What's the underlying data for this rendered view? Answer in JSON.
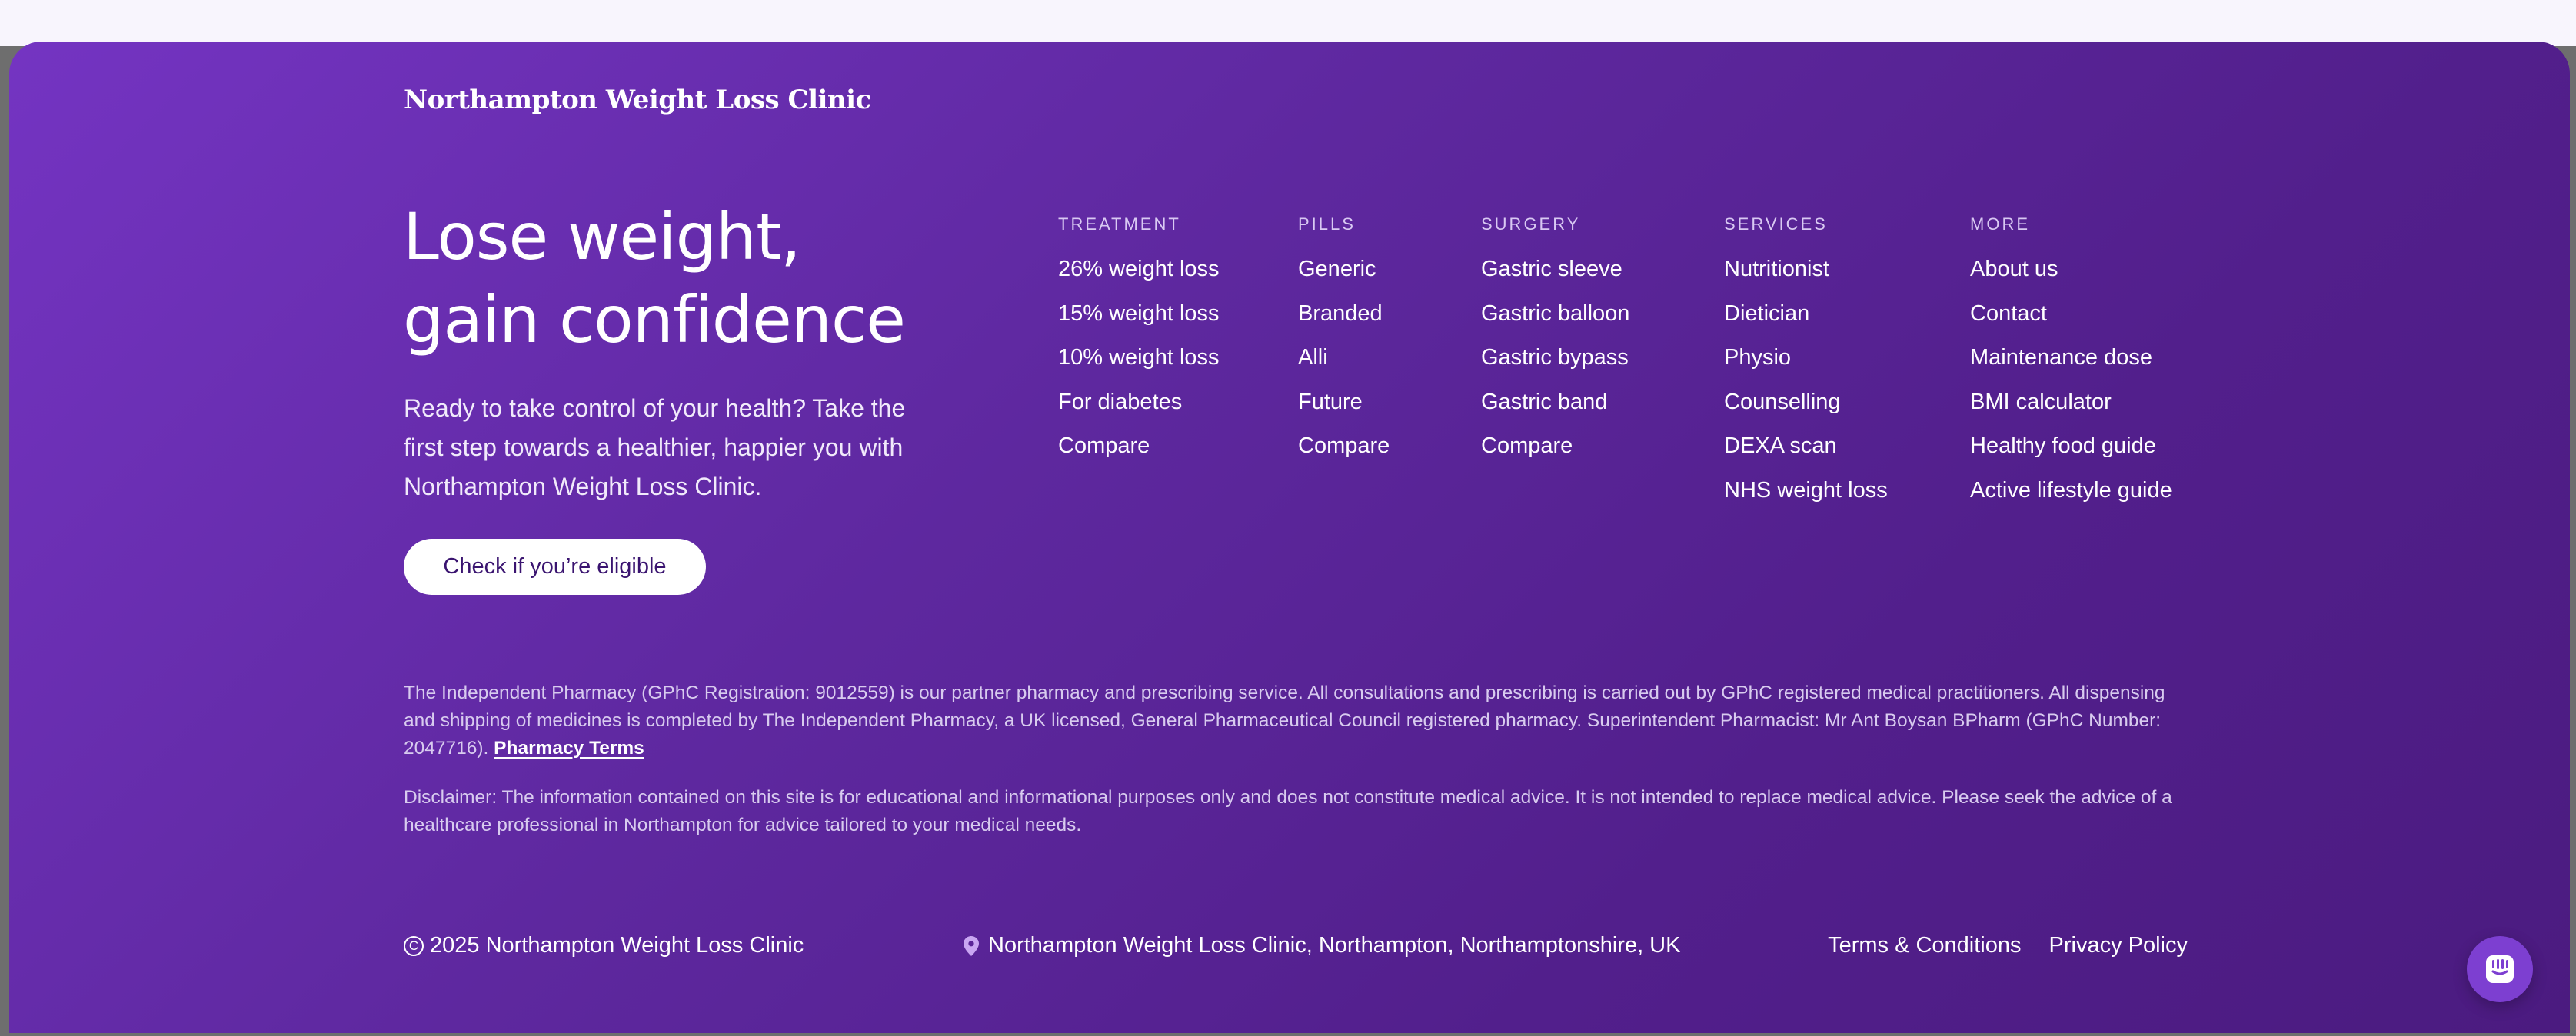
{
  "brand": "Northampton Weight Loss Clinic",
  "hero": {
    "headline_line1": "Lose weight,",
    "headline_line2": "gain confidence",
    "intro": "Ready to take control of your health? Take the first step towards a healthier, happier you with Northampton Weight Loss Clinic.",
    "cta_label": "Check if you’re eligible"
  },
  "nav": {
    "treatment": {
      "heading": "TREATMENT",
      "items": [
        "26% weight loss",
        "15% weight loss",
        "10% weight loss",
        "For diabetes",
        "Compare"
      ]
    },
    "pills": {
      "heading": "PILLS",
      "items": [
        "Generic",
        "Branded",
        "Alli",
        "Future",
        "Compare"
      ]
    },
    "surgery": {
      "heading": "SURGERY",
      "items": [
        "Gastric sleeve",
        "Gastric balloon",
        "Gastric bypass",
        "Gastric band",
        "Compare"
      ]
    },
    "services": {
      "heading": "SERVICES",
      "items": [
        "Nutritionist",
        "Dietician",
        "Physio",
        "Counselling",
        "DEXA scan",
        "NHS weight loss"
      ]
    },
    "more": {
      "heading": "MORE",
      "items": [
        "About us",
        "Contact",
        "Maintenance dose",
        "BMI calculator",
        "Healthy food guide",
        "Active lifestyle guide"
      ]
    }
  },
  "legal": {
    "pharmacy_text": "The Independent Pharmacy (GPhC Registration: 9012559) is our partner pharmacy and prescribing service. All consultations and prescribing is carried out by GPhC registered medical practitioners. All dispensing and shipping of medicines is completed by The Independent Pharmacy, a UK licensed, General Pharmaceutical Council registered pharmacy. Superintendent Pharmacist: Mr Ant Boysan BPharm (GPhC Number: 2047716). ",
    "pharmacy_link": "Pharmacy Terms",
    "disclaimer": "Disclaimer: The information contained on this site is for educational and informational purposes only and does not constitute medical advice. It is not intended to replace medical advice. Please seek the advice of a healthcare professional in Northampton for advice tailored to your medical needs."
  },
  "bottom": {
    "copyright_symbol": "C",
    "copyright": "2025 Northampton Weight Loss Clinic",
    "location": "Northampton Weight Loss Clinic, Northampton, Northamptonshire, UK",
    "terms": "Terms & Conditions",
    "privacy": "Privacy Policy"
  },
  "icons": {
    "location": "map-pin-icon",
    "copyright": "copyright-icon",
    "chat": "chat-icon"
  },
  "colors": {
    "footer_gradient_start": "#7434c2",
    "footer_gradient_end": "#4b1b80",
    "cta_text": "#3a1470",
    "chat_bubble": "#7d3fd1",
    "muted_text": "#d8cbef"
  }
}
